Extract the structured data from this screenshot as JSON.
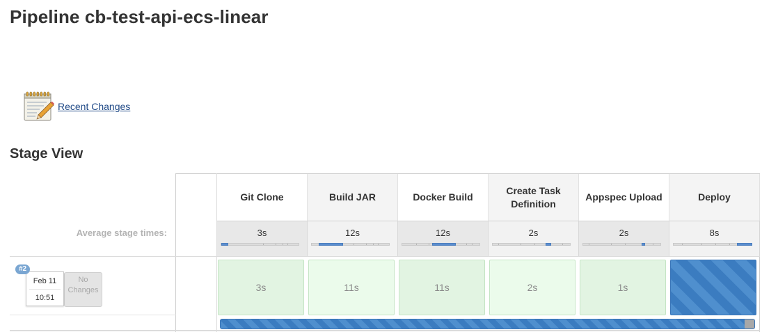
{
  "page": {
    "title": "Pipeline cb-test-api-ecs-linear"
  },
  "links": {
    "recent_changes": "Recent Changes"
  },
  "stage_view": {
    "title": "Stage View",
    "average_label": "Average stage times:",
    "stages": [
      {
        "name": "Git Clone",
        "avg": "3s",
        "avg_fill_fraction": 0.09,
        "build_time": "3s",
        "status": "success"
      },
      {
        "name": "Build JAR",
        "avg": "12s",
        "avg_fill_fraction": 0.4,
        "build_time": "11s",
        "status": "success"
      },
      {
        "name": "Docker Build",
        "avg": "12s",
        "avg_fill_fraction": 0.3,
        "build_time": "11s",
        "status": "success"
      },
      {
        "name": "Create Task Definition",
        "avg": "2s",
        "avg_fill_fraction": 0.07,
        "build_time": "2s",
        "status": "success"
      },
      {
        "name": "Appspec Upload",
        "avg": "2s",
        "avg_fill_fraction": 0.05,
        "build_time": "1s",
        "status": "success"
      },
      {
        "name": "Deploy",
        "avg": "8s",
        "avg_fill_fraction": 0.2,
        "build_time": "",
        "status": "in-progress"
      }
    ],
    "builds": [
      {
        "number": "#2",
        "date": "Feb 11",
        "time": "10:51",
        "changes": "No Changes"
      }
    ],
    "overall_progress_fraction": 0.98
  },
  "colors": {
    "success_bg": "#e2f4e2",
    "in_progress": "#4f8fce",
    "link": "#204a87",
    "badge": "#7aa6d2"
  }
}
